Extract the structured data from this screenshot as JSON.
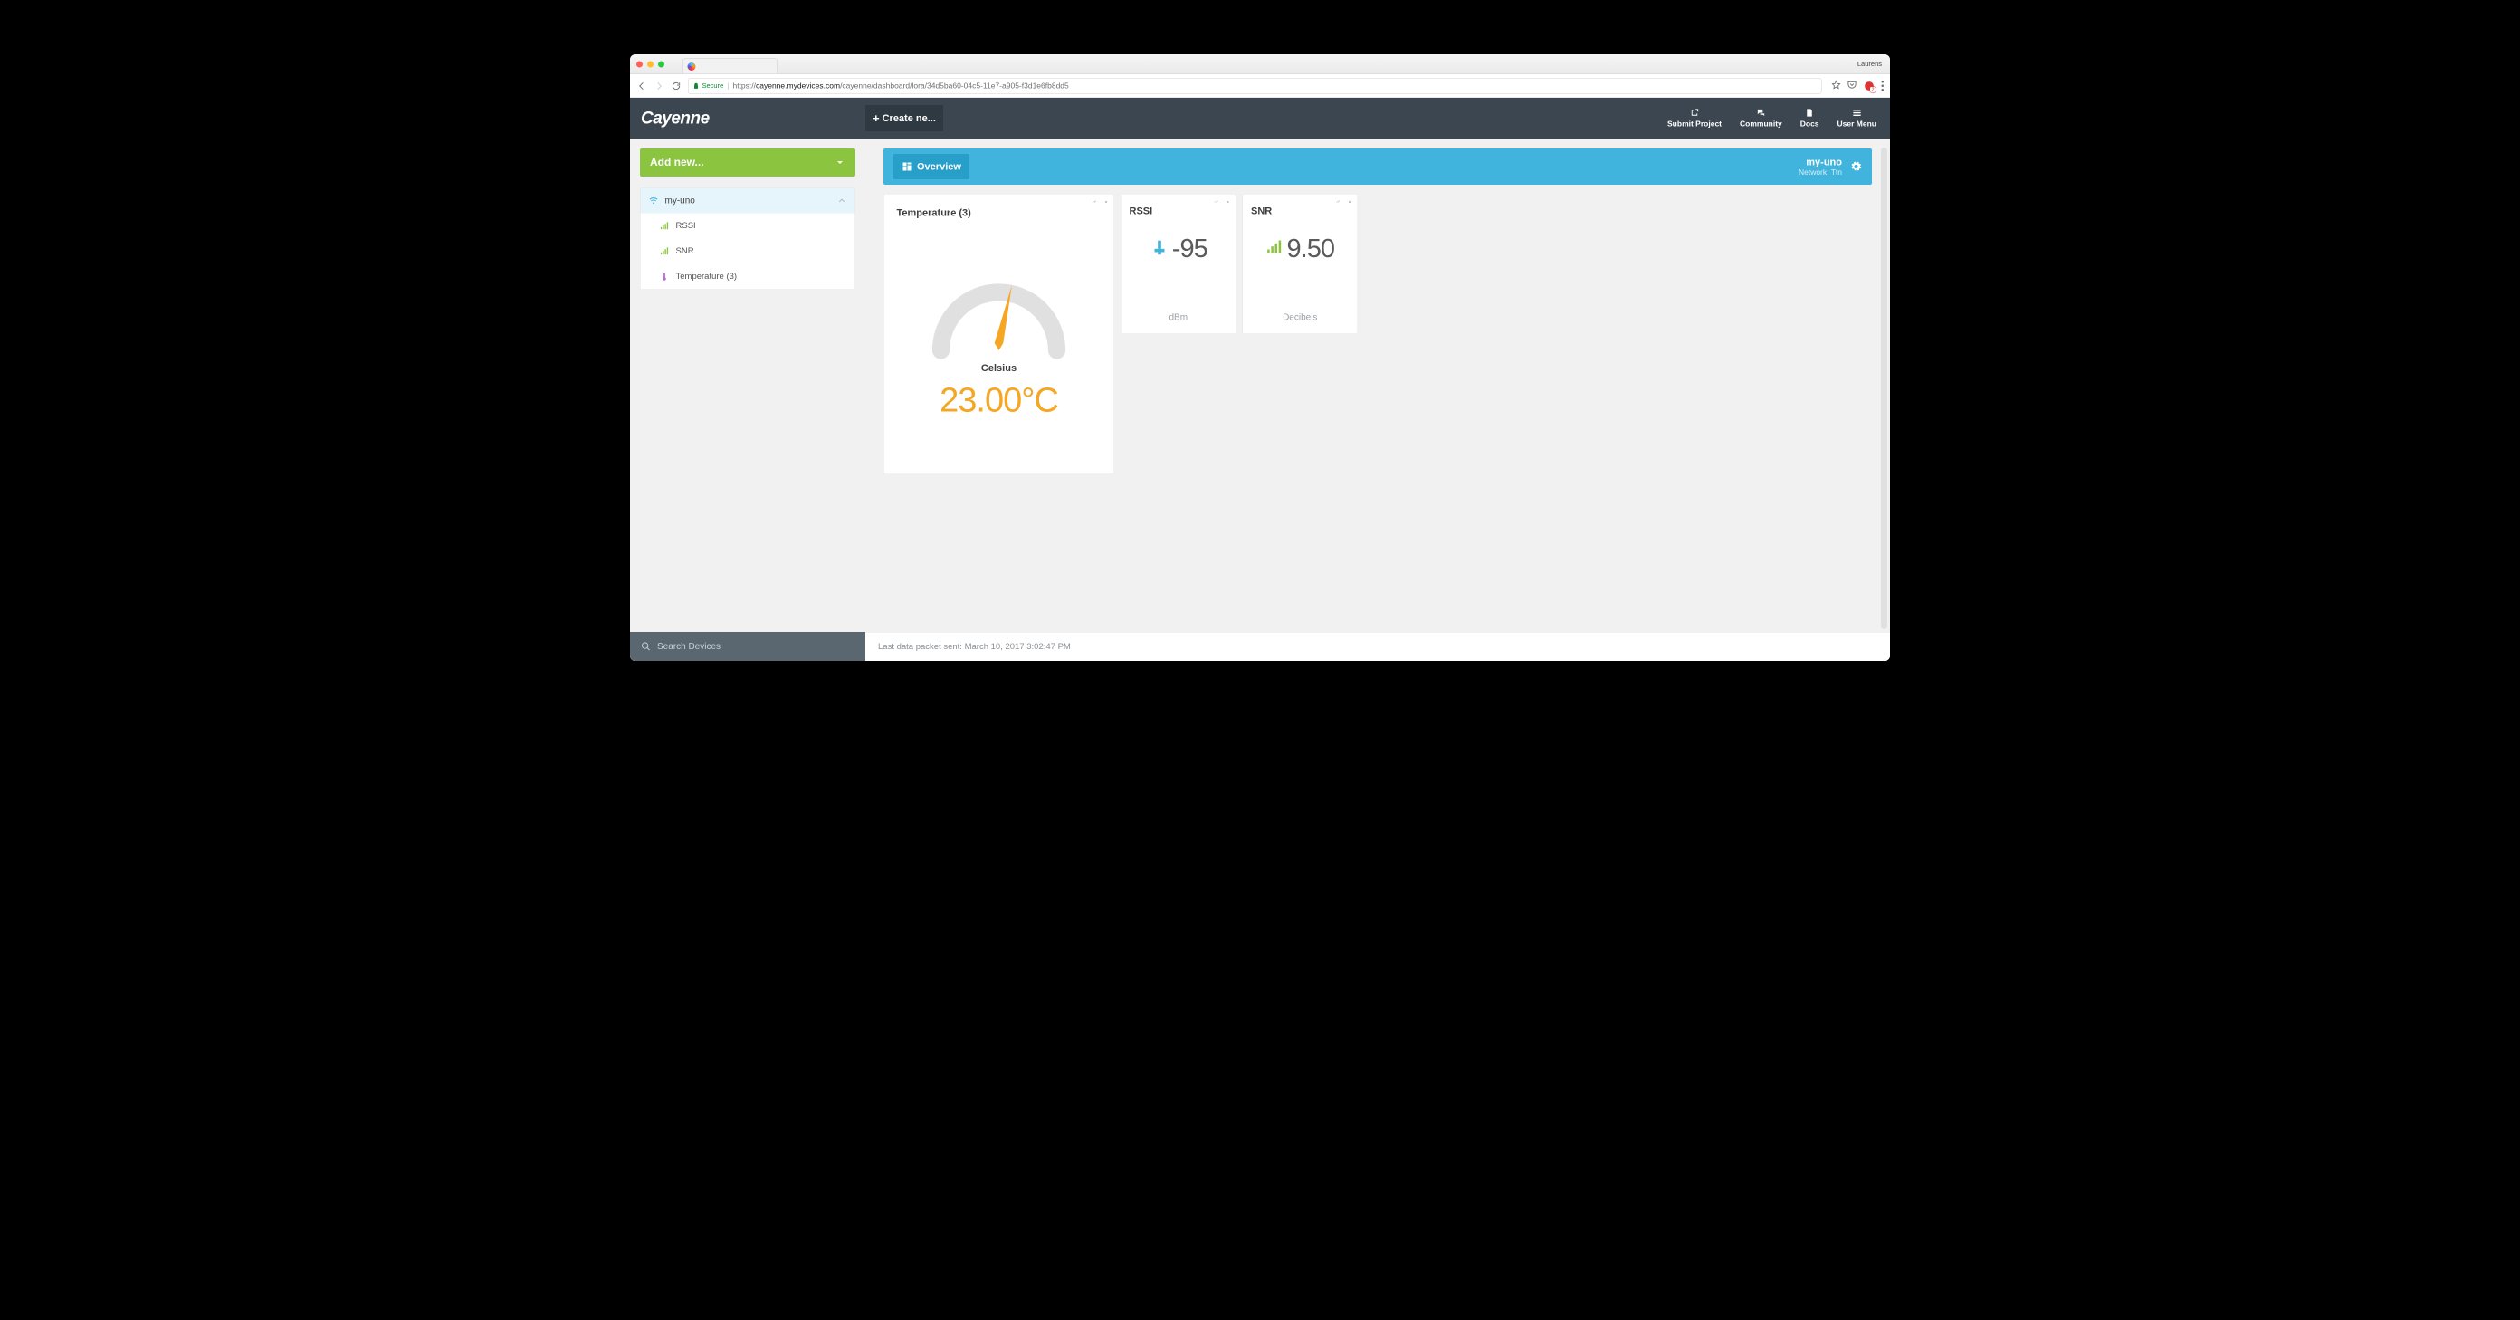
{
  "browser": {
    "profile_name": "Laurens",
    "secure_label": "Secure",
    "url_prefix": "https://",
    "url_host": "cayenne.mydevices.com",
    "url_path": "/cayenne/dashboard/lora/34d5ba60-04c5-11e7-a905-f3d1e6fb8dd5",
    "ext_badge_count": "2"
  },
  "header": {
    "logo": "Cayenne",
    "create_label": "Create ne...",
    "nav": {
      "submit": "Submit Project",
      "community": "Community",
      "docs": "Docs",
      "user_menu": "User Menu"
    }
  },
  "sidebar": {
    "add_new_label": "Add new...",
    "device_name": "my-uno",
    "children": [
      {
        "label": "RSSI"
      },
      {
        "label": "SNR"
      },
      {
        "label": "Temperature (3)"
      }
    ],
    "search_placeholder": "Search Devices"
  },
  "overview": {
    "tab_label": "Overview",
    "device_name": "my-uno",
    "network_label": "Network: Ttn"
  },
  "widgets": {
    "temperature": {
      "title": "Temperature (3)",
      "unit_label": "Celsius",
      "value_display": "23.00°C"
    },
    "rssi": {
      "title": "RSSI",
      "value_display": "-95",
      "unit": "dBm"
    },
    "snr": {
      "title": "SNR",
      "value_display": "9.50",
      "unit": "Decibels"
    }
  },
  "footer": {
    "last_packet": "Last data packet sent: March 10, 2017 3:02:47 PM"
  }
}
